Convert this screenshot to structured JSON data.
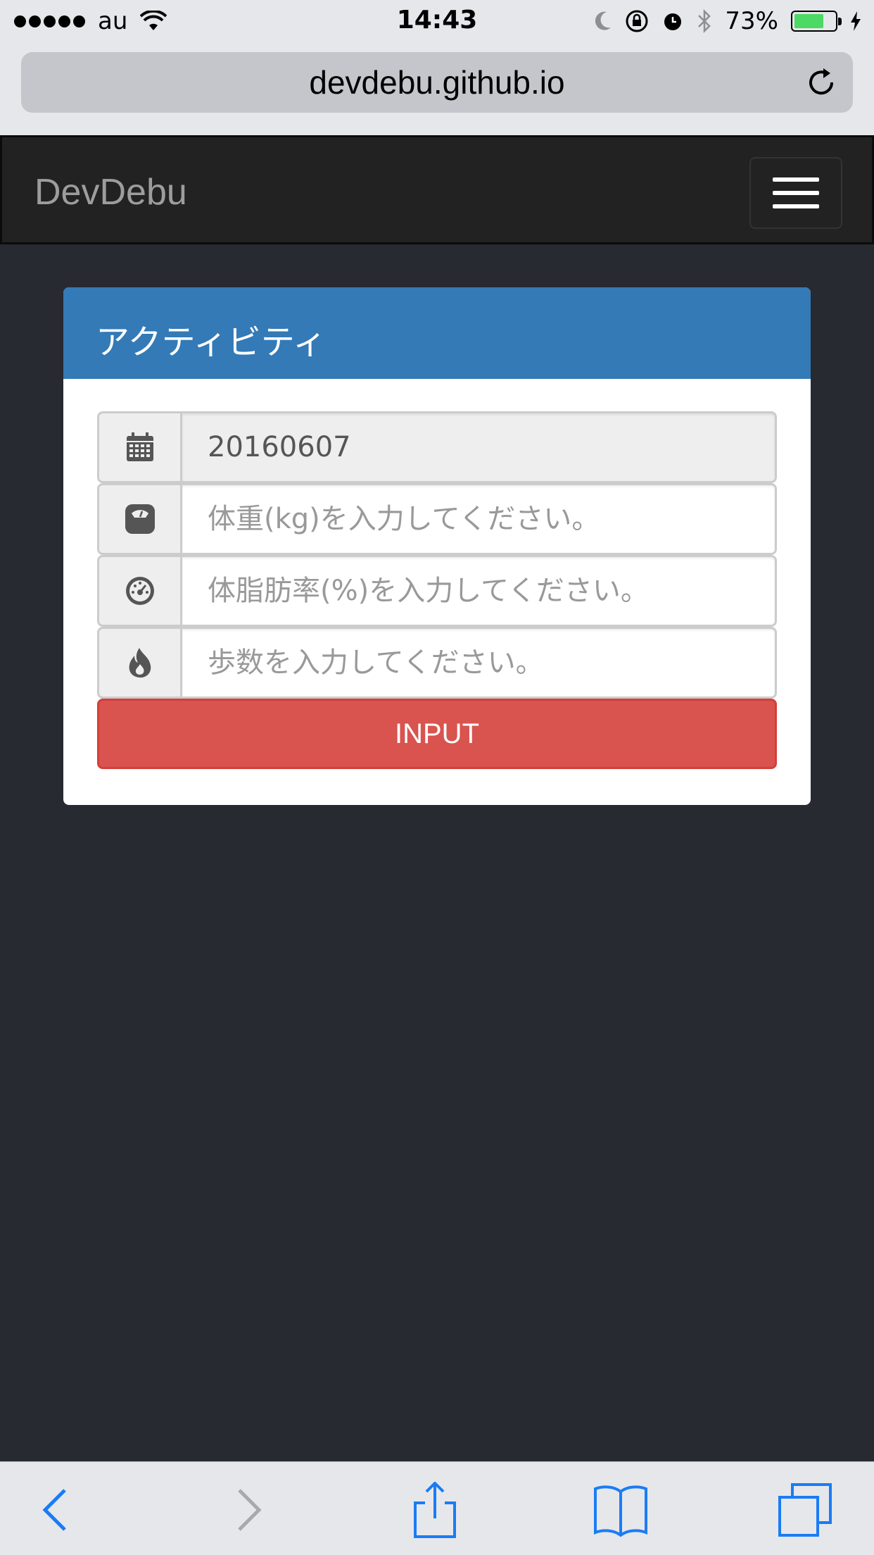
{
  "status_bar": {
    "carrier": "au",
    "time": "14:43",
    "battery_percent": "73%",
    "battery_level": 0.73
  },
  "browser": {
    "url": "devdebu.github.io"
  },
  "navbar": {
    "brand": "DevDebu"
  },
  "panel": {
    "title": "アクティビティ",
    "fields": [
      {
        "icon": "calendar-icon",
        "value": "20160607",
        "placeholder": ""
      },
      {
        "icon": "scale-icon",
        "value": "",
        "placeholder": "体重(kg)を入力してください。"
      },
      {
        "icon": "dashboard-icon",
        "value": "",
        "placeholder": "体脂肪率(%)を入力してください。"
      },
      {
        "icon": "fire-icon",
        "value": "",
        "placeholder": "歩数を入力してください。"
      }
    ],
    "submit_label": "INPUT"
  },
  "colors": {
    "panel_heading": "#337ab7",
    "button_danger": "#d9534f",
    "background": "#272a30",
    "ios_blue": "#1a7cf5"
  }
}
